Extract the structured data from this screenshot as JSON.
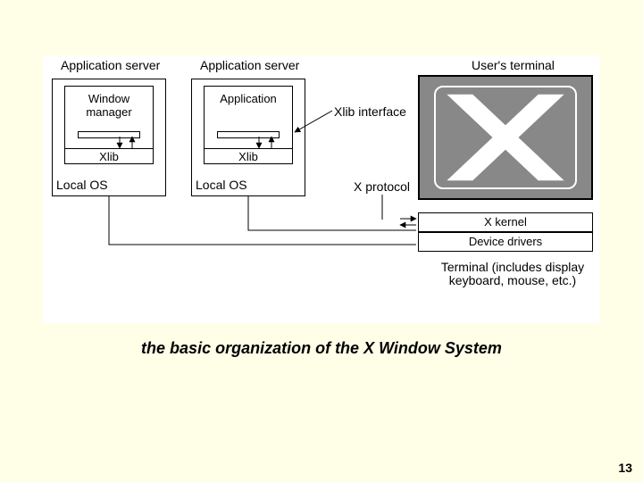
{
  "labels": {
    "appserver1": "Application server",
    "appserver2": "Application server",
    "userterminal": "User's terminal",
    "windowmanager": "Window\nmanager",
    "application": "Application",
    "xlib1": "Xlib",
    "xlib2": "Xlib",
    "localos1": "Local OS",
    "localos2": "Local OS",
    "xlibinterface": "Xlib interface",
    "xprotocol": "X protocol",
    "xkernel": "X kernel",
    "devicedrivers": "Device drivers",
    "terminalnote": "Terminal (includes display\nkeyboard, mouse, etc.)"
  },
  "caption": "the basic organization of the X Window System",
  "page": "13"
}
